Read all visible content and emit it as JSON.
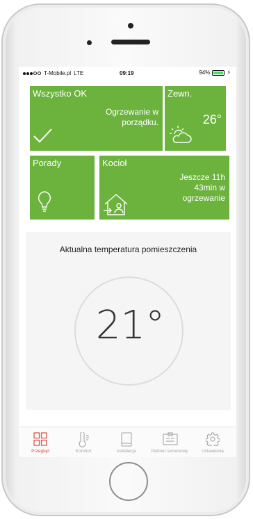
{
  "status_bar": {
    "carrier": "T-Mobile.pl",
    "network": "LTE",
    "time": "09:19",
    "battery": "94%",
    "battery_level": 0.94
  },
  "tiles": {
    "status": {
      "title": "Wszystko OK",
      "text": "Ogrzewanie w porządku.",
      "icon": "checkmark-icon"
    },
    "outside": {
      "title": "Zewn.",
      "value": "26°",
      "icon": "sun-cloud-icon"
    },
    "tips": {
      "title": "Porady",
      "icon": "lightbulb-icon"
    },
    "boiler": {
      "title": "Kocioł",
      "text": "Jeszcze 11h 43min w ogrzewanie",
      "icon": "house-icon"
    }
  },
  "room": {
    "label": "Aktualna temperatura pomieszczenia",
    "temperature": "21°"
  },
  "tabs": [
    {
      "label": "Przegląd",
      "icon": "grid-icon",
      "active": true
    },
    {
      "label": "Komfort",
      "icon": "thermometer-icon",
      "active": false
    },
    {
      "label": "Instalacja",
      "icon": "tablet-icon",
      "active": false
    },
    {
      "label": "Partner serwisowy",
      "icon": "id-card-icon",
      "active": false
    },
    {
      "label": "Ustawienia",
      "icon": "gear-icon",
      "active": false
    }
  ],
  "colors": {
    "tile_green": "#6cb33e",
    "active_tab": "#e04a3a",
    "inactive_tab": "#a5a5a5"
  }
}
